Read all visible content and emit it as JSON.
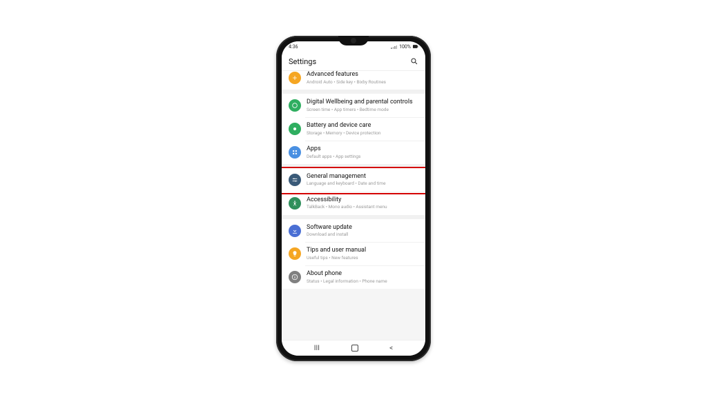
{
  "status": {
    "time": "4:36",
    "battery": "100%"
  },
  "header": {
    "title": "Settings"
  },
  "colors": {
    "adv": "#f5a623",
    "dw": "#2fae60",
    "bat": "#2fae60",
    "apps": "#4a90e2",
    "gm": "#3a5a78",
    "acc": "#2f8f5b",
    "sw": "#4a6fd4",
    "tips": "#f5a623",
    "about": "#808080"
  },
  "items": {
    "adv": {
      "title": "Advanced features",
      "sub": "Android Auto  •  Side key  •  Bixby Routines"
    },
    "dw": {
      "title": "Digital Wellbeing and parental controls",
      "sub": "Screen time  •  App timers  •  Bedtime mode"
    },
    "bat": {
      "title": "Battery and device care",
      "sub": "Storage  •  Memory  •  Device protection"
    },
    "apps": {
      "title": "Apps",
      "sub": "Default apps  •  App settings"
    },
    "gm": {
      "title": "General management",
      "sub": "Language and keyboard  •  Date and time"
    },
    "acc": {
      "title": "Accessibility",
      "sub": "TalkBack  •  Mono audio  •  Assistant menu"
    },
    "sw": {
      "title": "Software update",
      "sub": "Download and install"
    },
    "tips": {
      "title": "Tips and user manual",
      "sub": "Useful tips  •  New features"
    },
    "about": {
      "title": "About phone",
      "sub": "Status  •  Legal information  •  Phone name"
    }
  },
  "highlight": "gm"
}
